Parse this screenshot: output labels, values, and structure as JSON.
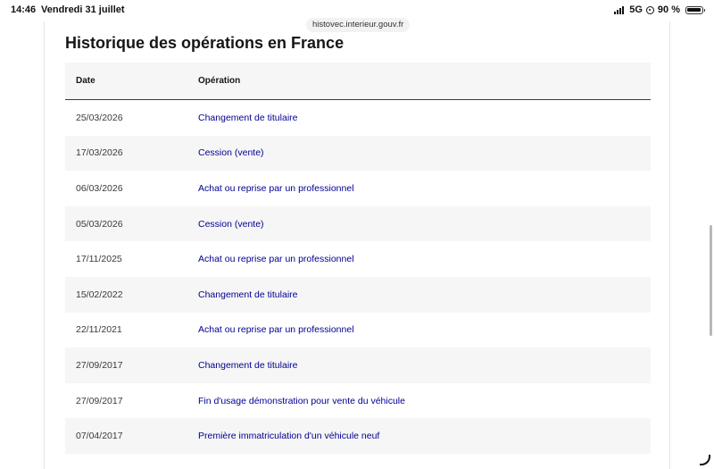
{
  "status_bar": {
    "time": "14:46",
    "date": "Vendredi 31 juillet",
    "network": "5G",
    "battery": "90 %",
    "icons": [
      "signal-icon",
      "lock-rotation-icon",
      "battery-icon"
    ]
  },
  "browser": {
    "url": "histovec.interieur.gouv.fr"
  },
  "section": {
    "title": "Historique des opérations en France"
  },
  "table": {
    "headers": [
      "Date",
      "Opération"
    ],
    "rows": [
      {
        "date": "25/03/2026",
        "operation": "Changement de titulaire"
      },
      {
        "date": "17/03/2026",
        "operation": "Cession (vente)"
      },
      {
        "date": "06/03/2026",
        "operation": "Achat ou reprise par un professionnel"
      },
      {
        "date": "05/03/2026",
        "operation": "Cession (vente)"
      },
      {
        "date": "17/11/2025",
        "operation": "Achat ou reprise par un professionnel"
      },
      {
        "date": "15/02/2022",
        "operation": "Changement de titulaire"
      },
      {
        "date": "22/11/2021",
        "operation": "Achat ou reprise par un professionnel"
      },
      {
        "date": "27/09/2017",
        "operation": "Changement de titulaire"
      },
      {
        "date": "27/09/2017",
        "operation": "Fin d'usage démonstration pour vente du véhicule"
      },
      {
        "date": "07/04/2017",
        "operation": "Première immatriculation d'un véhicule neuf"
      }
    ]
  },
  "colors": {
    "link": "#000091",
    "stripe": "#f6f6f6",
    "text": "#161616"
  }
}
